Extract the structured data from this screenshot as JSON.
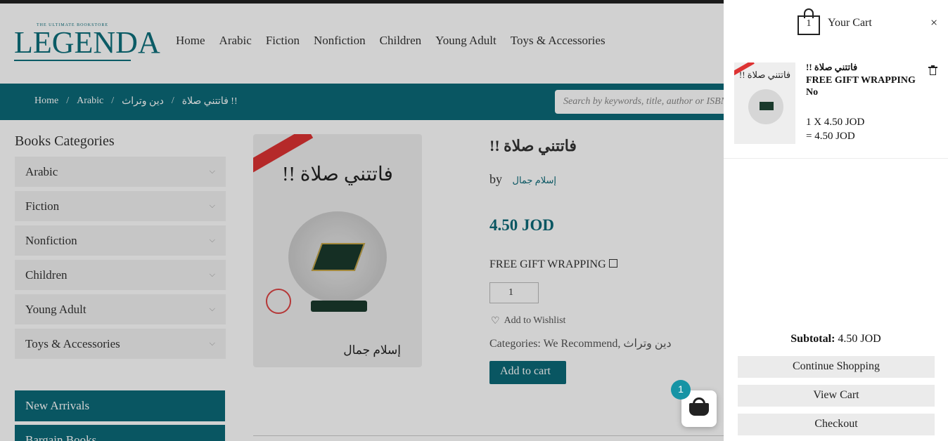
{
  "header": {
    "logo_small": "THE ULTIMATE BOOKSTORE",
    "logo_text": "LEGENDA",
    "nav": [
      "Home",
      "Arabic",
      "Fiction",
      "Nonfiction",
      "Children",
      "Young Adult",
      "Toys & Accessories"
    ]
  },
  "breadcrumb": [
    "Home",
    "Arabic",
    "دين وتراث",
    "فاتتني صلاة !!"
  ],
  "search": {
    "placeholder": "Search by keywords, title, author or ISBN"
  },
  "sidebar": {
    "title": "Books Categories",
    "categories": [
      "Arabic",
      "Fiction",
      "Nonfiction",
      "Children",
      "Young Adult",
      "Toys & Accessories"
    ],
    "highlights": [
      "New Arrivals",
      "Bargain Books"
    ]
  },
  "product": {
    "cover_title": "فاتتني صلاة !!",
    "cover_author": "إسلام جمال",
    "title": "فاتتني صلاة !!",
    "by": "by",
    "author": "إسلام جمال",
    "price": "4.50 JOD",
    "gift_label": "FREE GIFT WRAPPING",
    "qty": "1",
    "wishlist": "Add to Wishlist",
    "categories_label": "Categories:",
    "categories": "We Recommend, دين وتراث",
    "add_to_cart": "Add to cart"
  },
  "cart": {
    "count": "1",
    "title": "Your Cart",
    "close": "×",
    "item": {
      "name": "فاتتني صلاة !!",
      "gift": "FREE GIFT WRAPPING",
      "gift_value": "No",
      "qty_line": "1 X 4.50 JOD",
      "total_line": "= 4.50 JOD"
    },
    "subtotal_label": "Subtotal:",
    "subtotal_value": "4.50 JOD",
    "buttons": {
      "continue": "Continue Shopping",
      "view": "View Cart",
      "checkout": "Checkout"
    }
  },
  "fab": {
    "badge": "1"
  },
  "colors": {
    "brand": "#0b6a78",
    "badge": "#1694a5"
  }
}
